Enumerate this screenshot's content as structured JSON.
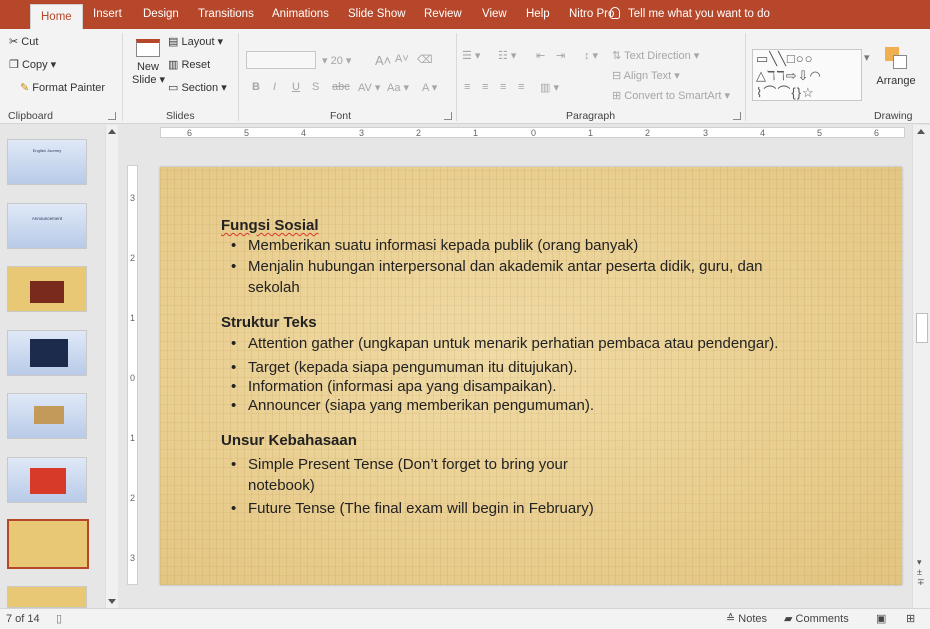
{
  "tabs": [
    {
      "label": "Home",
      "active": true
    },
    {
      "label": "Insert"
    },
    {
      "label": "Design"
    },
    {
      "label": "Transitions"
    },
    {
      "label": "Animations"
    },
    {
      "label": "Slide Show"
    },
    {
      "label": "Review"
    },
    {
      "label": "View"
    },
    {
      "label": "Help"
    },
    {
      "label": "Nitro Pro"
    }
  ],
  "tell_me": "Tell me what you want to do",
  "ribbon": {
    "clipboard": {
      "cut": "Cut",
      "copy": "Copy",
      "format_painter": "Format Painter",
      "label": "Clipboard"
    },
    "slides": {
      "new_slide_1": "New",
      "new_slide_2": "Slide",
      "layout": "Layout",
      "reset": "Reset",
      "section": "Section",
      "label": "Slides"
    },
    "font": {
      "size": "20",
      "grow": "A",
      "shrink": "A",
      "label": "Font",
      "bold": "B",
      "italic": "I",
      "underline": "U",
      "shadow": "S",
      "strike": "abc",
      "spacing": "AV",
      "case": "Aa",
      "color": "A"
    },
    "paragraph": {
      "text_direction": "Text Direction",
      "align_text": "Align Text",
      "convert_smartart": "Convert to SmartArt",
      "label": "Paragraph"
    },
    "drawing": {
      "arrange": "Arrange",
      "label": "Drawing"
    }
  },
  "ruler": {
    "h": [
      "6",
      "5",
      "4",
      "3",
      "2",
      "1",
      "0",
      "1",
      "2",
      "3",
      "4",
      "5",
      "6"
    ],
    "v": [
      "3",
      "2",
      "1",
      "0",
      "1",
      "2",
      "3"
    ]
  },
  "thumbnails": {
    "t1_title": "English Journey",
    "t2_title": "Announcement"
  },
  "slide": {
    "h1": "Fungsi Sosial",
    "b1": "Memberikan suatu informasi kepada publik (orang banyak)",
    "b2a": "Menjalin hubungan interpersonal dan akademik antar peserta didik, guru, dan",
    "b2b": "sekolah",
    "h2": "Struktur Teks",
    "b3": "Attention gather (ungkapan untuk menarik perhatian pembaca atau pendengar).",
    "b4": "Target (kepada siapa pengumuman itu ditujukan).",
    "b5": "Information (informasi apa yang disampaikan).",
    "b6": "Announcer (siapa yang memberikan pengumuman).",
    "h3": "Unsur Kebahasaan",
    "b7a": "Simple Present Tense (Don’t forget to bring your",
    "b7b": "notebook)",
    "b8": "Future Tense (The final exam will begin in February)"
  },
  "status": {
    "slide_count": "7 of 14",
    "notes": "Notes",
    "comments": "Comments"
  },
  "colors": {
    "accent": "#b7472a",
    "slide_bg": "#e7cc8c"
  }
}
